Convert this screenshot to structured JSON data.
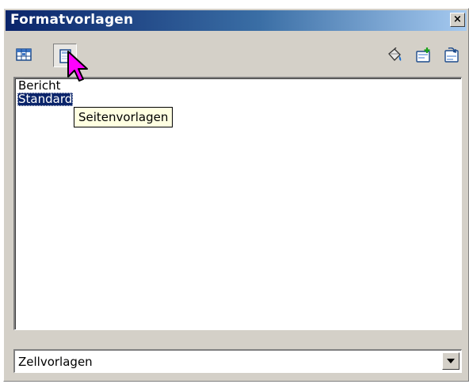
{
  "window": {
    "title": "Formatvorlagen",
    "close_glyph": "×"
  },
  "toolbar": {
    "left_buttons": [
      {
        "icon": "cell-styles-icon",
        "pressed": false
      },
      {
        "icon": "page-styles-icon",
        "pressed": true
      }
    ],
    "right_buttons": [
      {
        "icon": "fill-format-mode-icon"
      },
      {
        "icon": "new-style-from-selection-icon"
      },
      {
        "icon": "update-style-icon"
      }
    ]
  },
  "style_list": {
    "items": [
      {
        "label": "Bericht",
        "selected": false
      },
      {
        "label": "Standard",
        "selected": true
      }
    ]
  },
  "tooltip": {
    "text": "Seitenvorlagen"
  },
  "filter_combo": {
    "value": "Zellvorlagen"
  },
  "colors": {
    "title_start": "#0a246a",
    "title_end": "#a6caf0",
    "selection": "#0a246a",
    "tooltip_bg": "#ffffe1",
    "cursor": "#ff00ff"
  }
}
